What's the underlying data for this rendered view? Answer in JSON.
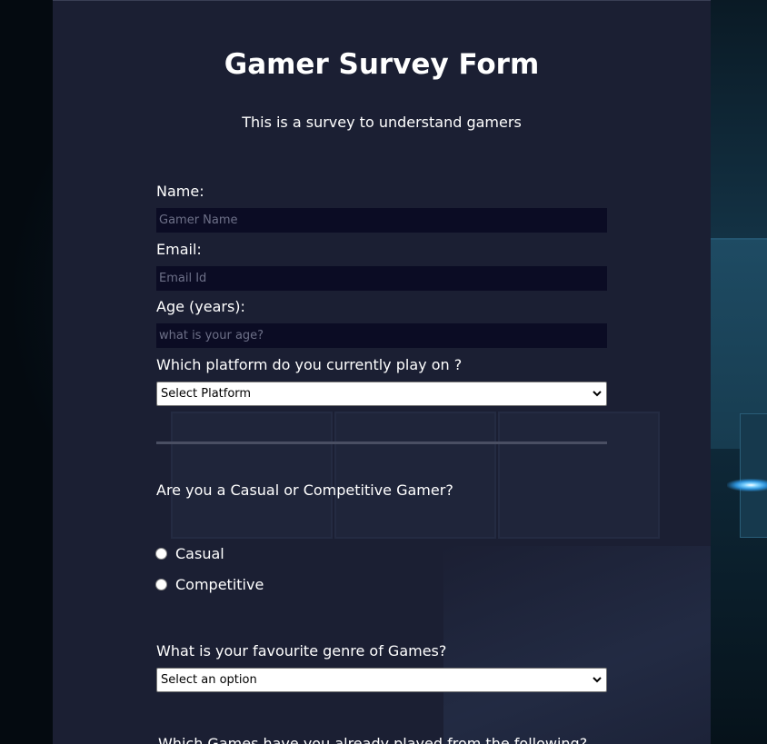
{
  "form": {
    "title": "Gamer Survey Form",
    "subtitle": "This is a survey to understand gamers",
    "name": {
      "label": "Name:",
      "placeholder": "Gamer Name",
      "value": ""
    },
    "email": {
      "label": "Email:",
      "placeholder": "Email Id",
      "value": ""
    },
    "age": {
      "label": "Age (years):",
      "placeholder": "what is your age?",
      "value": ""
    },
    "platform": {
      "label": "Which platform do you currently play on ?",
      "selected": "Select Platform"
    },
    "gamer_type": {
      "label": "Are you a Casual or Competitive Gamer?",
      "options": [
        "Casual",
        "Competitive"
      ],
      "selected": null
    },
    "genre": {
      "label": "What is your favourite genre of Games?",
      "selected": "Select an option"
    },
    "games_played": {
      "label": "Which Games have you already played from the following?"
    }
  },
  "icons": {
    "select_arrow": "chevron-down-icon"
  },
  "colors": {
    "panel_bg": "#1b1f33",
    "input_bg": "#0b0c24",
    "text": "#ffffff"
  }
}
